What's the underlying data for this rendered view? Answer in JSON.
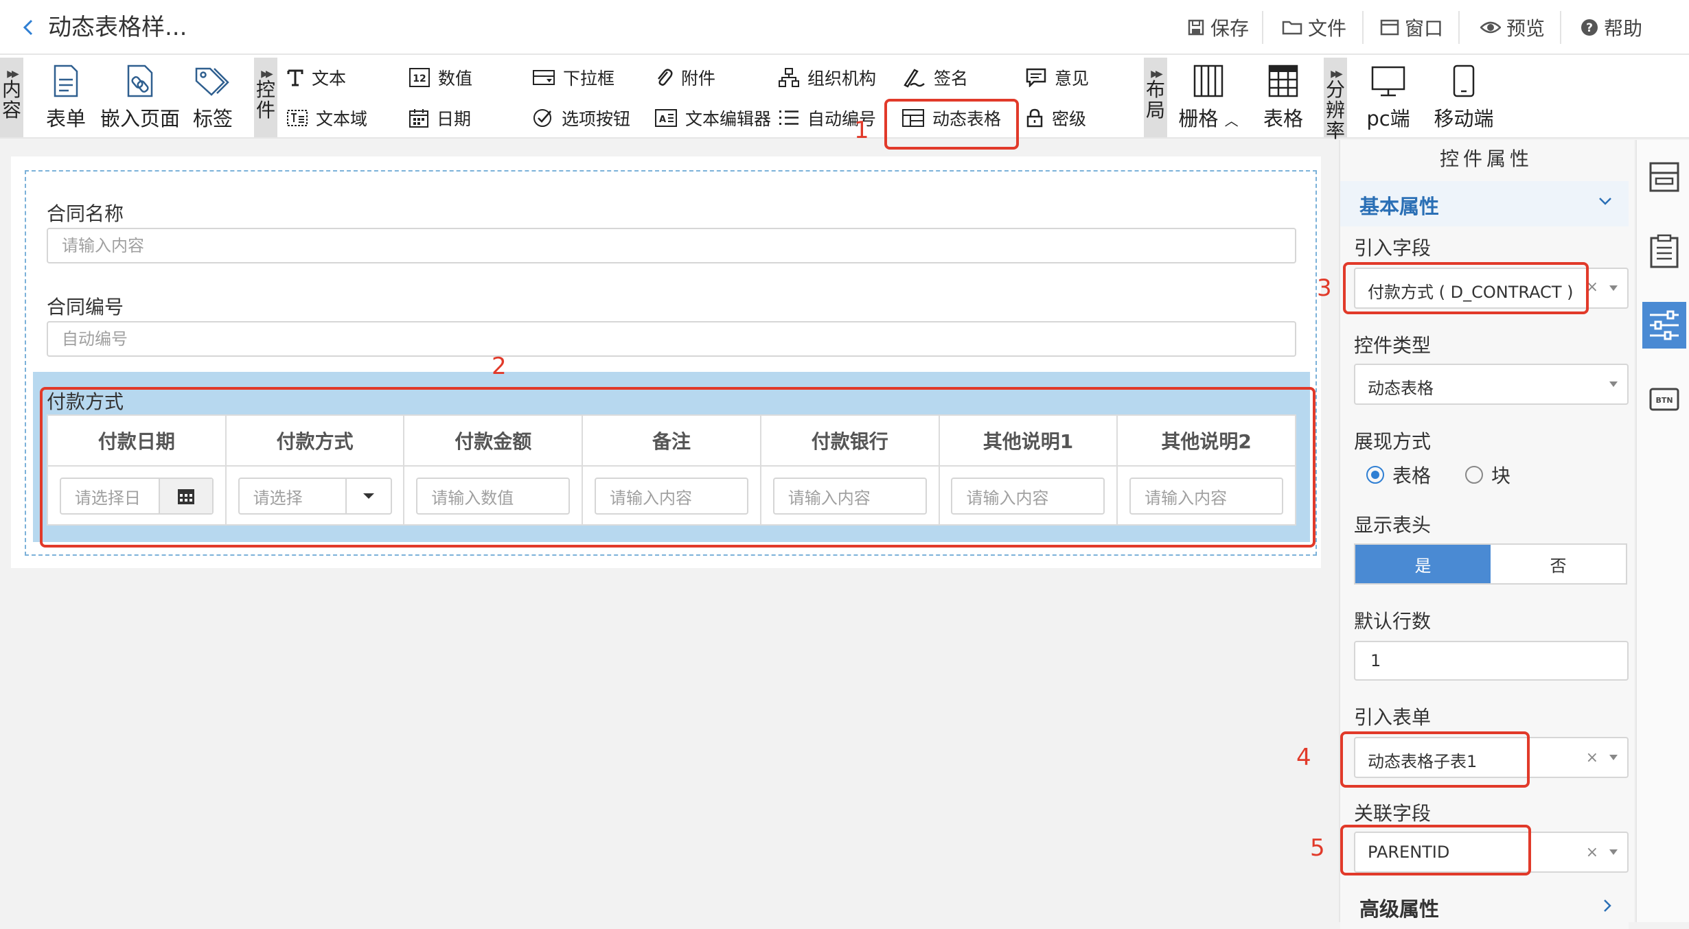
{
  "header": {
    "title": "动态表格样...",
    "menu": [
      {
        "label": "保存",
        "icon": "save-icon"
      },
      {
        "label": "文件",
        "icon": "folder-icon"
      },
      {
        "label": "窗口",
        "icon": "window-icon"
      },
      {
        "label": "预览",
        "icon": "eye-icon"
      },
      {
        "label": "帮助",
        "icon": "help-icon"
      }
    ]
  },
  "toolbar": {
    "groups": {
      "content": "内容",
      "controls": "控件",
      "layout": "布局",
      "resolution": "分辨率"
    },
    "content_tools": [
      {
        "label": "表单",
        "icon": "form-icon"
      },
      {
        "label": "嵌入页面",
        "icon": "embed-link-icon"
      },
      {
        "label": "标签",
        "icon": "tag-icon"
      }
    ],
    "control_tools_row1": [
      {
        "label": "文本",
        "icon": "text-icon"
      },
      {
        "label": "数值",
        "icon": "number-icon"
      },
      {
        "label": "下拉框",
        "icon": "dropdown-icon"
      },
      {
        "label": "附件",
        "icon": "paperclip-icon"
      },
      {
        "label": "组织机构",
        "icon": "org-chart-icon"
      },
      {
        "label": "签名",
        "icon": "signature-icon"
      },
      {
        "label": "意见",
        "icon": "comment-icon"
      }
    ],
    "control_tools_row2": [
      {
        "label": "文本域",
        "icon": "textarea-icon"
      },
      {
        "label": "日期",
        "icon": "calendar-icon"
      },
      {
        "label": "选项按钮",
        "icon": "radio-option-icon"
      },
      {
        "label": "文本编辑器",
        "icon": "rich-editor-icon"
      },
      {
        "label": "自动编号",
        "icon": "list-number-icon"
      },
      {
        "label": "动态表格",
        "icon": "dynamic-table-icon"
      },
      {
        "label": "密级",
        "icon": "lock-icon"
      }
    ],
    "layout_tools": [
      {
        "label": "栅格",
        "icon": "grid-columns-icon"
      },
      {
        "label": "表格",
        "icon": "table-icon"
      }
    ],
    "resolution_tools": [
      {
        "label": "pc端",
        "icon": "monitor-icon"
      },
      {
        "label": "移动端",
        "icon": "mobile-icon"
      }
    ]
  },
  "annotations": [
    "1",
    "2",
    "3",
    "4",
    "5"
  ],
  "form": {
    "fields": [
      {
        "label": "合同名称",
        "placeholder": "请输入内容"
      },
      {
        "label": "合同编号",
        "placeholder": "自动编号"
      }
    ],
    "dynamic_table": {
      "title": "付款方式",
      "columns": [
        "付款日期",
        "付款方式",
        "付款金额",
        "备注",
        "付款银行",
        "其他说明1",
        "其他说明2"
      ],
      "placeholders": [
        "请选择日",
        "请选择",
        "请输入数值",
        "请输入内容",
        "请输入内容",
        "请输入内容",
        "请输入内容"
      ]
    }
  },
  "panel": {
    "title": "控件属性",
    "basic_section": "基本属性",
    "advanced_section": "高级属性",
    "field_label": "引入字段",
    "field_value": "付款方式 ( D_CONTRACT )",
    "type_label": "控件类型",
    "type_value": "动态表格",
    "display_label": "展现方式",
    "display_options": [
      "表格",
      "块"
    ],
    "display_selected": "表格",
    "header_label": "显示表头",
    "header_options": [
      "是",
      "否"
    ],
    "header_selected": "是",
    "rows_label": "默认行数",
    "rows_value": "1",
    "subform_label": "引入表单",
    "subform_value": "动态表格子表1",
    "link_label": "关联字段",
    "link_value": "PARENTID",
    "clear_glyph": "×"
  },
  "colors": {
    "accent": "#4a8ad3",
    "annotation": "#e13a2a",
    "table_bg": "#b7d8ef"
  }
}
